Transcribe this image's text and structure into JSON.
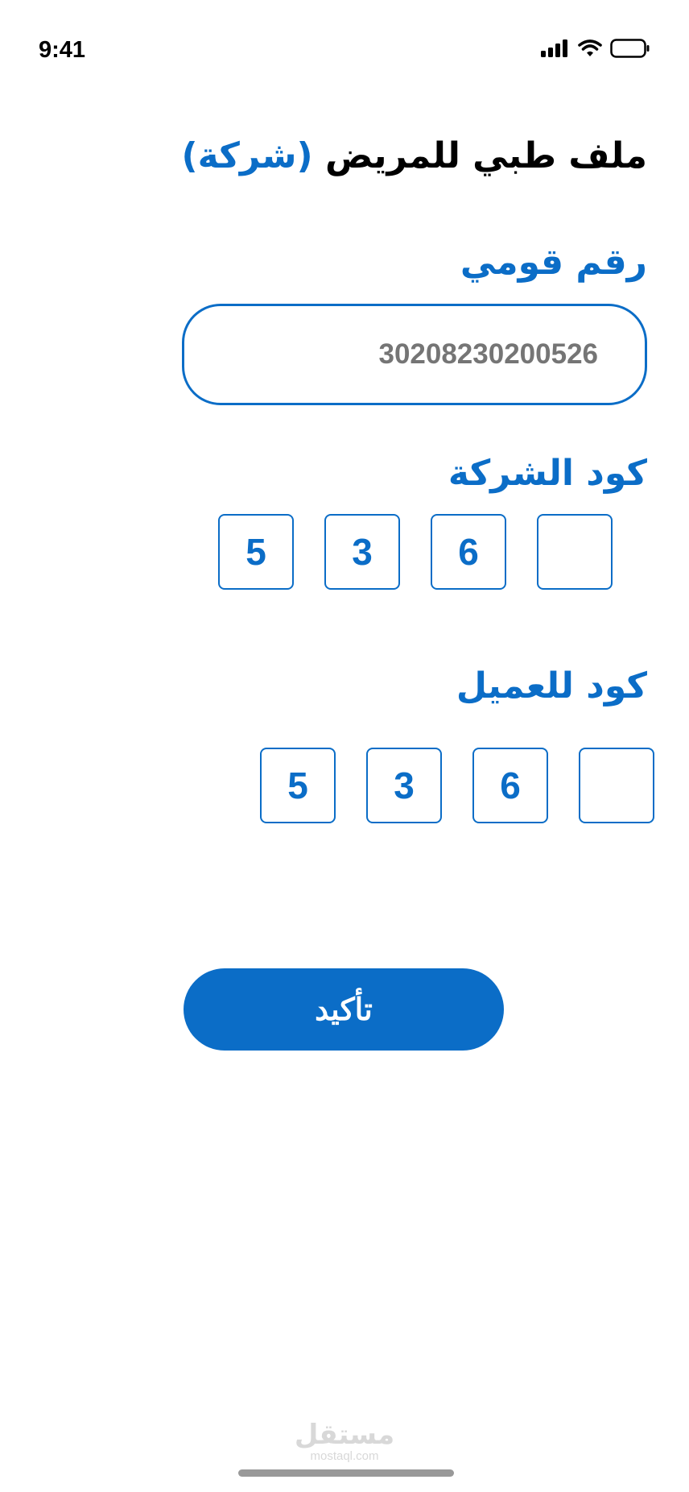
{
  "status_bar": {
    "time": "9:41",
    "icons": [
      "signal-icon",
      "wifi-icon",
      "battery-icon"
    ]
  },
  "title": {
    "main": "ملف طبي للمريض",
    "accent": "(شركة)"
  },
  "national_id": {
    "label": "رقم قومي",
    "placeholder": "30208230200526"
  },
  "company_code": {
    "label": "كود الشركة",
    "digits": [
      "5",
      "3",
      "6",
      ""
    ]
  },
  "client_code": {
    "label": "كود للعميل",
    "digits": [
      "5",
      "3",
      "6",
      ""
    ]
  },
  "confirm_button": "تأكيد",
  "watermark": {
    "arabic": "مستقل",
    "latin": "mostaql.com"
  },
  "colors": {
    "accent": "#0b6dc7",
    "placeholder": "#b9bfc7"
  }
}
